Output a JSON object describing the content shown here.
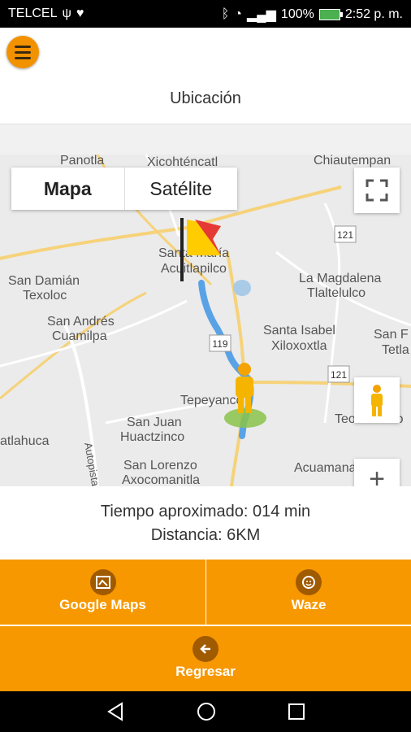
{
  "status_bar": {
    "carrier": "TELCEL",
    "battery_percent": "100%",
    "time": "2:52 p. m."
  },
  "header": {
    "title": "Ubicación"
  },
  "map": {
    "map_type_options": [
      "Mapa",
      "Satélite"
    ],
    "selected_map_type": "Mapa",
    "zoom_in_label": "+",
    "route_shield": "119",
    "road_shields": [
      "121",
      "121"
    ],
    "place_labels": [
      "Panotla",
      "Xicohténcatl",
      "Chiautempan",
      "Santa María Acuitlapilco",
      "San Damián Texoloc",
      "San Andrés Cuamilpa",
      "La Magdalena Tlaltelulco",
      "Santa Isabel Xiloxoxtla",
      "San F Tetla",
      "Tepeyanco",
      "San Juan Huactzinco",
      "San Lorenzo Axocomanitla",
      "Acuamanala",
      "Teolocholco",
      "atlahuca",
      "Autopista"
    ]
  },
  "info": {
    "time_text": "Tiempo aproximado: 014 min",
    "distance_text": "Distancia: 6KM"
  },
  "actions": {
    "google_maps_label": "Google Maps",
    "waze_label": "Waze",
    "back_label": "Regresar"
  },
  "colors": {
    "accent": "#f79800",
    "route": "#5aa2e6",
    "status_bar": "#000000"
  }
}
